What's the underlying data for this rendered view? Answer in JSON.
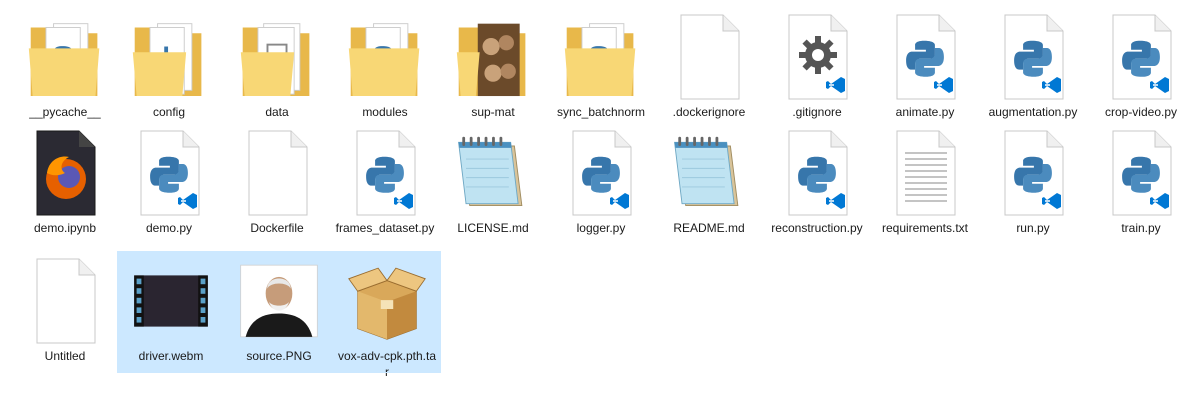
{
  "files": [
    {
      "name": "__pycache__",
      "type": "folder-python",
      "selected": false
    },
    {
      "name": "config",
      "type": "folder-config",
      "selected": false
    },
    {
      "name": "data",
      "type": "folder-data",
      "selected": false
    },
    {
      "name": "modules",
      "type": "folder-python",
      "selected": false
    },
    {
      "name": "sup-mat",
      "type": "folder-image",
      "selected": false
    },
    {
      "name": "sync_batchnorm",
      "type": "folder-python",
      "selected": false
    },
    {
      "name": ".dockerignore",
      "type": "file-blank",
      "selected": false
    },
    {
      "name": ".gitignore",
      "type": "file-gear",
      "selected": false
    },
    {
      "name": "animate.py",
      "type": "file-python",
      "selected": false
    },
    {
      "name": "augmentation.py",
      "type": "file-python",
      "selected": false
    },
    {
      "name": "crop-video.py",
      "type": "file-python",
      "selected": false
    },
    {
      "name": "demo.ipynb",
      "type": "file-firefox",
      "selected": false
    },
    {
      "name": "demo.py",
      "type": "file-python",
      "selected": false
    },
    {
      "name": "Dockerfile",
      "type": "file-blank",
      "selected": false
    },
    {
      "name": "frames_dataset.py",
      "type": "file-python",
      "selected": false
    },
    {
      "name": "LICENSE.md",
      "type": "file-notepad",
      "selected": false
    },
    {
      "name": "logger.py",
      "type": "file-python",
      "selected": false
    },
    {
      "name": "README.md",
      "type": "file-notepad",
      "selected": false
    },
    {
      "name": "reconstruction.py",
      "type": "file-python",
      "selected": false
    },
    {
      "name": "requirements.txt",
      "type": "file-text",
      "selected": false
    },
    {
      "name": "run.py",
      "type": "file-python",
      "selected": false
    },
    {
      "name": "train.py",
      "type": "file-python",
      "selected": false
    },
    {
      "name": "Untitled",
      "type": "file-blank",
      "selected": false
    },
    {
      "name": "driver.webm",
      "type": "file-video",
      "selected": true
    },
    {
      "name": "source.PNG",
      "type": "file-photo",
      "selected": true
    },
    {
      "name": "vox-adv-cpk.pth.tar",
      "type": "file-archive",
      "selected": true
    }
  ],
  "colors": {
    "selection": "#cce8ff",
    "folder": "#f8d775",
    "python_blue": "#3776ab",
    "python_teal": "#4b8bbe",
    "vscode_blue": "#0078d4"
  }
}
